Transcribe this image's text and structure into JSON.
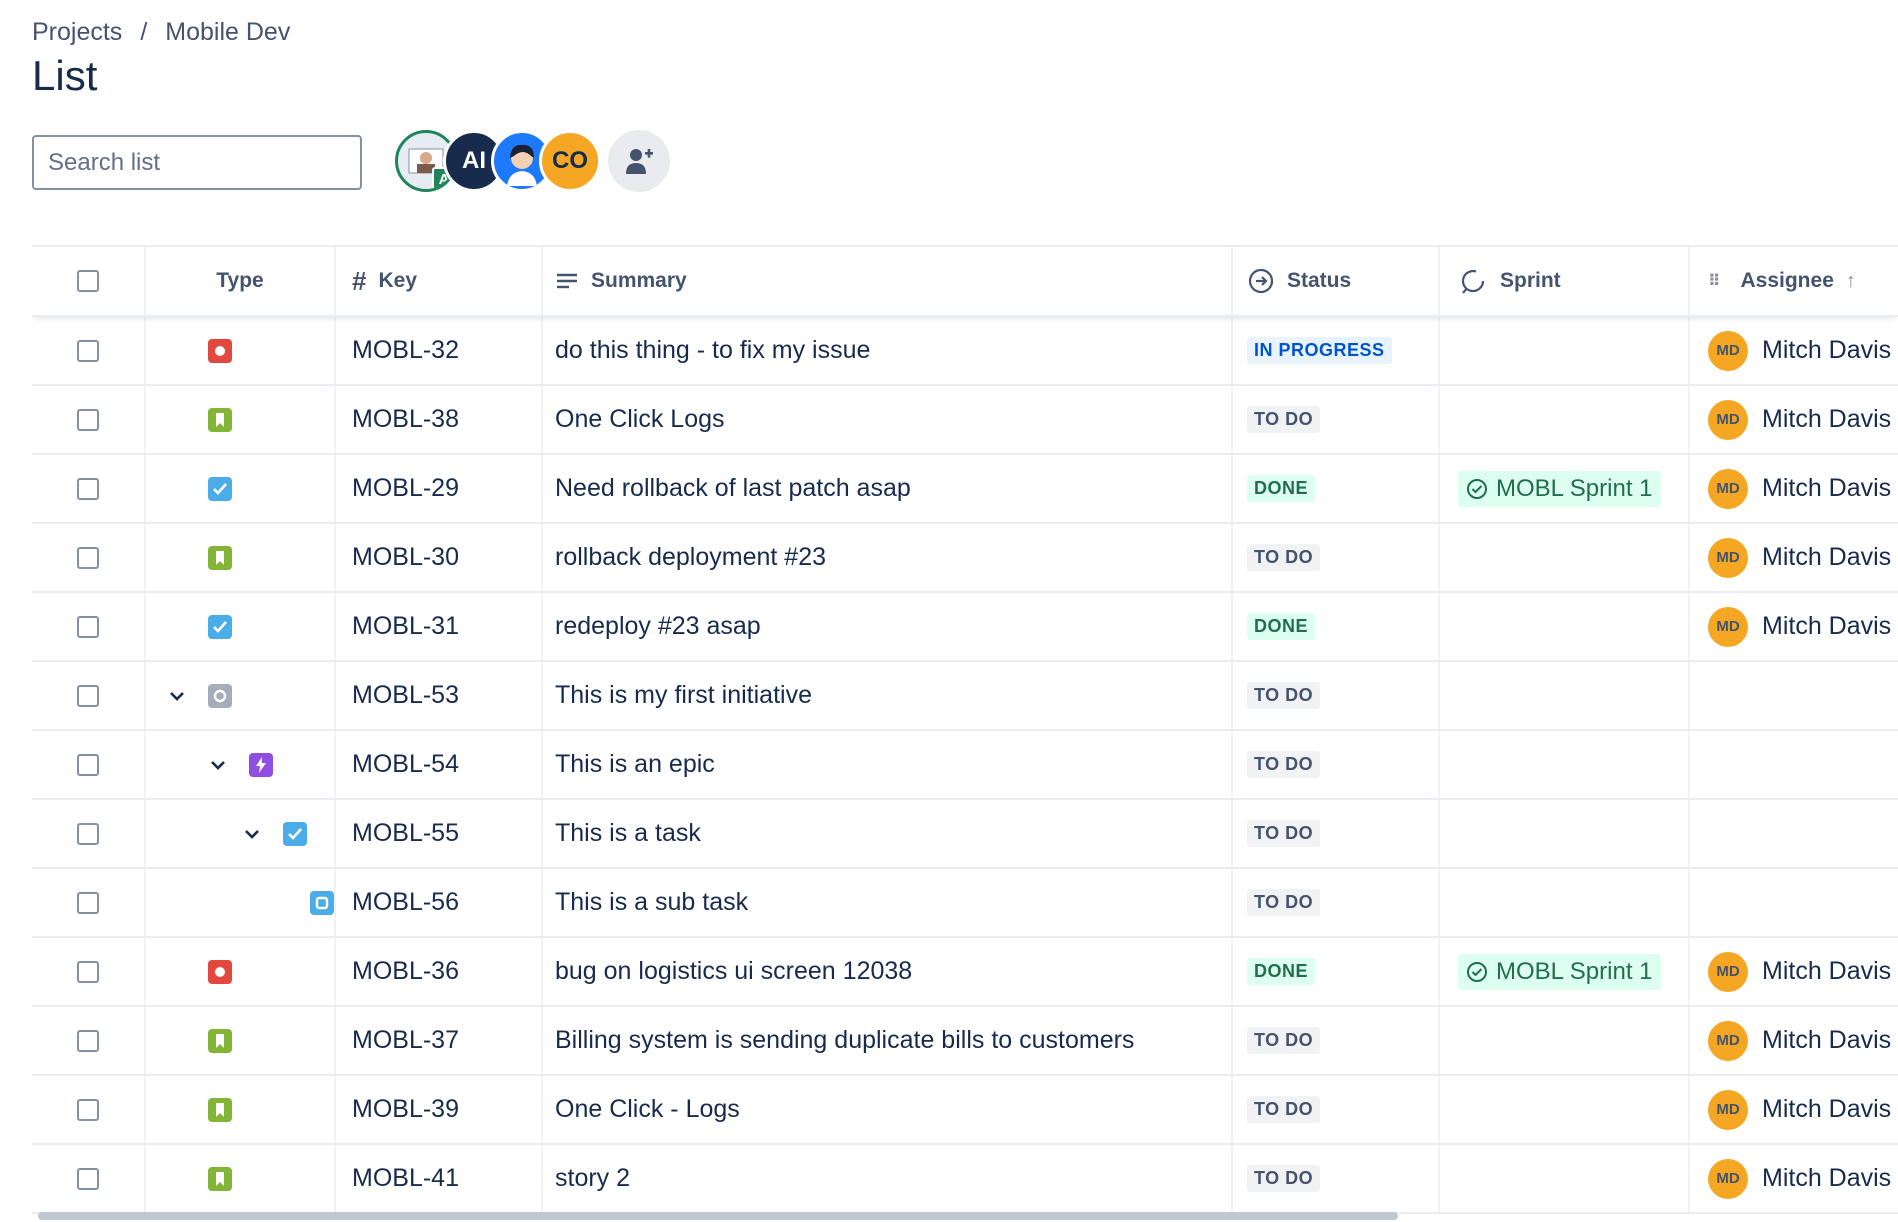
{
  "breadcrumb": {
    "projects": "Projects",
    "separator": "/",
    "project": "Mobile Dev"
  },
  "page_title": "List",
  "search": {
    "placeholder": "Search list",
    "icon": "search-icon"
  },
  "avatars": {
    "ai": "AI",
    "co": "CO",
    "photo_badge": "A"
  },
  "columns": {
    "type": "Type",
    "key": "Key",
    "summary": "Summary",
    "status": "Status",
    "sprint": "Sprint",
    "assignee": "Assignee"
  },
  "rows": [
    {
      "type": "bug",
      "key": "MOBL-32",
      "summary": "do this thing - to fix my issue",
      "status": "IN PROGRESS",
      "sprint": "",
      "assignee": "Mitch Davis",
      "initials": "MD"
    },
    {
      "type": "story",
      "key": "MOBL-38",
      "summary": "One Click Logs",
      "status": "TO DO",
      "sprint": "",
      "assignee": "Mitch Davis",
      "initials": "MD"
    },
    {
      "type": "task",
      "key": "MOBL-29",
      "summary": "Need rollback of last patch asap",
      "status": "DONE",
      "sprint": "MOBL Sprint 1",
      "assignee": "Mitch Davis",
      "initials": "MD"
    },
    {
      "type": "story",
      "key": "MOBL-30",
      "summary": "rollback deployment #23",
      "status": "TO DO",
      "sprint": "",
      "assignee": "Mitch Davis",
      "initials": "MD"
    },
    {
      "type": "task",
      "key": "MOBL-31",
      "summary": "redeploy #23 asap",
      "status": "DONE",
      "sprint": "",
      "assignee": "Mitch Davis",
      "initials": "MD"
    },
    {
      "type": "initiative",
      "key": "MOBL-53",
      "summary": "This is my first initiative",
      "status": "TO DO",
      "sprint": "",
      "assignee": "",
      "initials": "",
      "expandable": true,
      "level": 0
    },
    {
      "type": "epic",
      "key": "MOBL-54",
      "summary": "This is an epic",
      "status": "TO DO",
      "sprint": "",
      "assignee": "",
      "initials": "",
      "expandable": true,
      "level": 1
    },
    {
      "type": "task",
      "key": "MOBL-55",
      "summary": "This is a task",
      "status": "TO DO",
      "sprint": "",
      "assignee": "",
      "initials": "",
      "expandable": true,
      "level": 2
    },
    {
      "type": "subtask",
      "key": "MOBL-56",
      "summary": "This is a sub task",
      "status": "TO DO",
      "sprint": "",
      "assignee": "",
      "initials": "",
      "level": 3
    },
    {
      "type": "bug",
      "key": "MOBL-36",
      "summary": "bug on logistics ui screen 12038",
      "status": "DONE",
      "sprint": "MOBL Sprint 1",
      "assignee": "Mitch Davis",
      "initials": "MD"
    },
    {
      "type": "story",
      "key": "MOBL-37",
      "summary": "Billing system is sending duplicate bills to customers",
      "status": "TO DO",
      "sprint": "",
      "assignee": "Mitch Davis",
      "initials": "MD"
    },
    {
      "type": "story",
      "key": "MOBL-39",
      "summary": "One Click - Logs",
      "status": "TO DO",
      "sprint": "",
      "assignee": "Mitch Davis",
      "initials": "MD"
    },
    {
      "type": "story",
      "key": "MOBL-41",
      "summary": "story 2",
      "status": "TO DO",
      "sprint": "",
      "assignee": "Mitch Davis",
      "initials": "MD"
    }
  ],
  "colors": {
    "bug": "#e2483d",
    "story": "#82b536",
    "task": "#4bade8",
    "initiative": "#a5adba",
    "epic": "#904ee2",
    "subtask": "#4bade8",
    "todo_bg": "#f1f2f4",
    "done_bg": "#dcfff1",
    "progress_bg": "#e9f2ff",
    "assignee_avatar": "#f5a623"
  }
}
